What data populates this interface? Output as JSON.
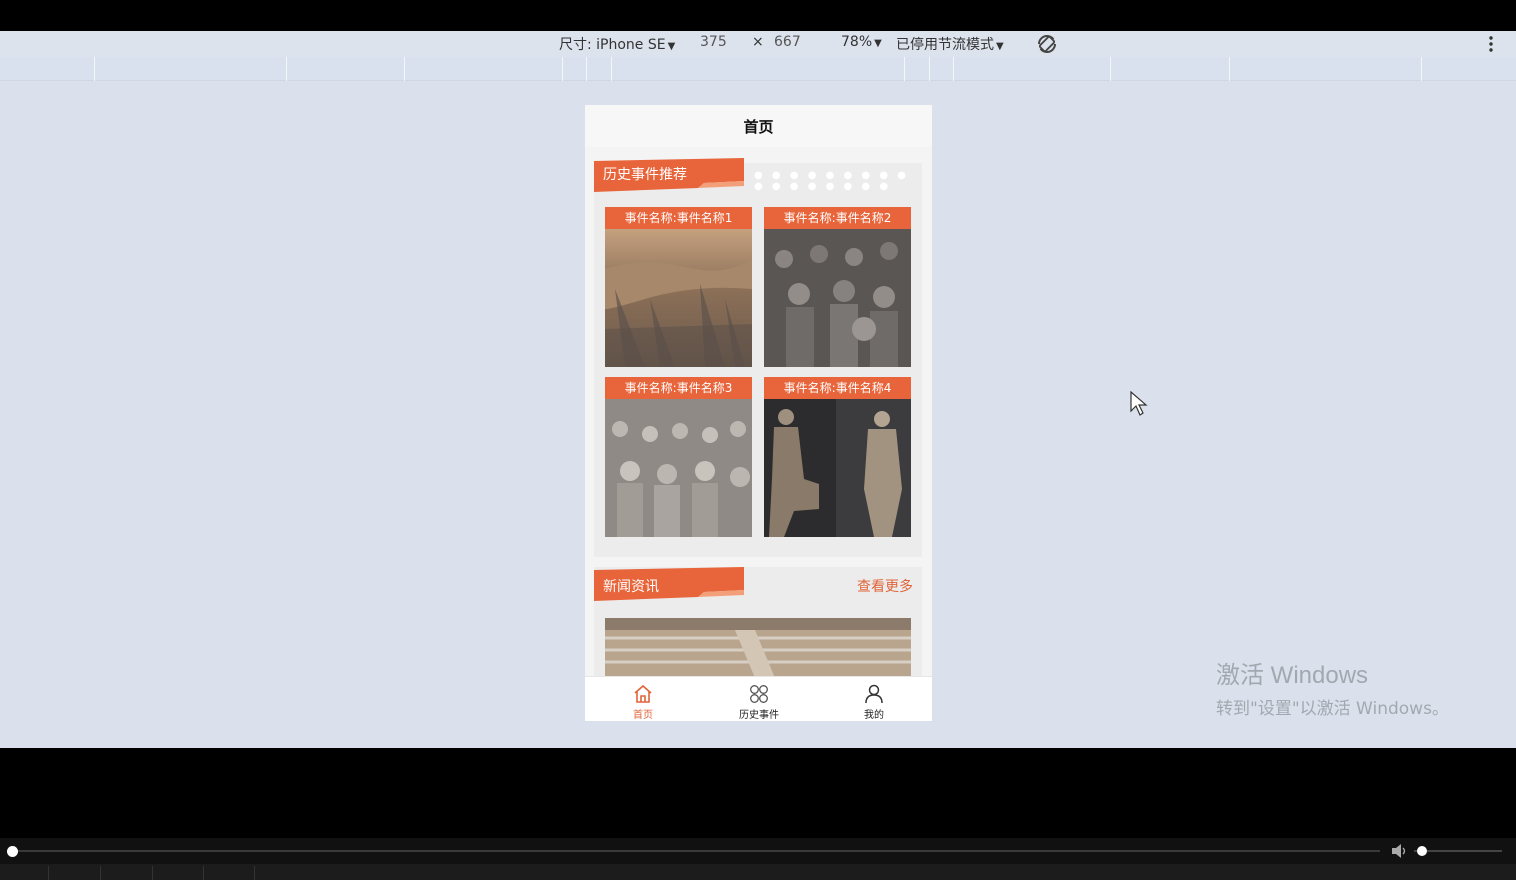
{
  "devtools": {
    "device_label": "尺寸: iPhone SE",
    "width": "375",
    "times": "×",
    "height": "667",
    "zoom": "78%",
    "throttle": "已停用节流模式"
  },
  "page": {
    "title": "首页",
    "history_section": {
      "title": "历史事件推荐",
      "dots": "● ● ● ● ● ● ● ● ● ● ● ● ● ● ● ● ●",
      "events": [
        {
          "label": "事件名称:事件名称1"
        },
        {
          "label": "事件名称:事件名称2"
        },
        {
          "label": "事件名称:事件名称3"
        },
        {
          "label": "事件名称:事件名称4"
        }
      ]
    },
    "news_section": {
      "title": "新闻资讯",
      "more_link": "查看更多"
    },
    "tabbar": [
      {
        "label": "首页",
        "icon": "home-icon",
        "active": true
      },
      {
        "label": "历史事件",
        "icon": "grid-icon",
        "active": false
      },
      {
        "label": "我的",
        "icon": "user-icon",
        "active": false
      }
    ]
  },
  "watermark": {
    "line1": "激活 Windows",
    "line2": "转到\"设置\"以激活 Windows。"
  },
  "player": {
    "seek_fraction": 0.0,
    "volume_fraction": 0.05
  },
  "colors": {
    "accent": "#e8643a",
    "viewport_bg": "#dae1ec"
  }
}
